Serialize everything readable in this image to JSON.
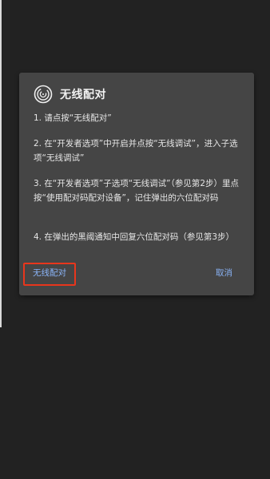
{
  "dialog": {
    "title": "无线配对",
    "steps": [
      "1. 请点按“无线配对”",
      "2. 在“开发者选项”中开启并点按“无线调试”，进入子选项“无线调试”",
      "3. 在“开发者选项”子选项“无线调试”（参见第2步）里点按“使用配对码配对设备”，记住弹出的六位配对码",
      "4. 在弹出的黑阈通知中回复六位配对码（参见第3步）"
    ],
    "pair_button_label": "无线配对",
    "cancel_button_label": "取消"
  },
  "colors": {
    "screen_background": "#222222",
    "dialog_background": "#454545",
    "text": "#e6e6e6",
    "button_text": "#8ab4f8",
    "highlight_border": "#e8361c"
  },
  "icons": {
    "app": "spiral-icon"
  }
}
